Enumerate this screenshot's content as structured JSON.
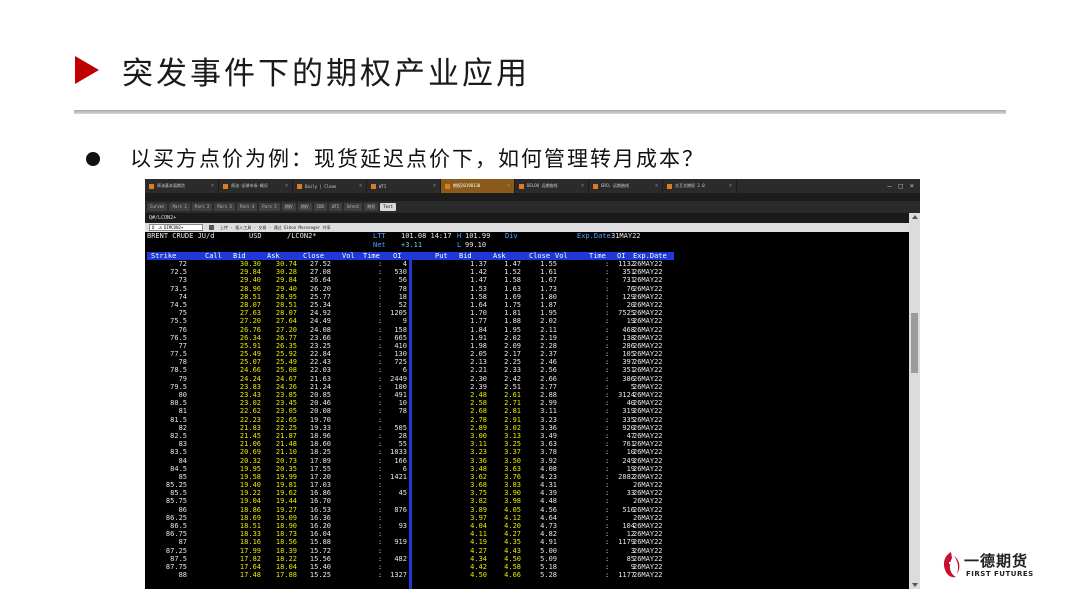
{
  "slide": {
    "title": "突发事件下的期权产业应用",
    "bullet": "以买方点价为例：现货延迟点价下，如何管理转月成本？"
  },
  "logo": {
    "cn": "一德期货",
    "en": "FIRST FUTURES",
    "icon": "first-futures-logo"
  },
  "colors": {
    "accent_red": "#c00000",
    "header_blue": "#1f39d8",
    "put_yellow": "#e8e800"
  },
  "terminal": {
    "tabs": [
      "原油基本面期货",
      "原油-全球市场-概况",
      "Daily | Clean",
      "WTI",
      "期权20190130",
      "DELOO 远期曲线",
      "GRCL 远期曲线",
      "交互式期权 2.0"
    ],
    "active_tab": 4,
    "function_tabs": [
      "Curves",
      "Pars 1",
      "Pars 2",
      "Pars 3",
      "Pars 4",
      "Pars 5",
      "期权",
      "期权",
      "CDD",
      "WTI",
      "Brent",
      "期权",
      "Test"
    ],
    "function_active": 12,
    "path": "Q#/LCON2+",
    "command_value": "Q .a DIMCON2+",
    "command_hint": "上传 · 插入工具 · 交易 · 通过 Eikon Messenger 共享",
    "header": {
      "instrument": "BRENT CRUDE JU/d",
      "currency": "USD",
      "ric": "/LCON2*",
      "ltt_label": "LTT",
      "ltt_value": "101.08 14:17",
      "h_label": "H",
      "h_value": "101.99",
      "div_label": "Div",
      "exp_label": "Exp.Date",
      "exp_value": "31MAY22",
      "net_label": "Net",
      "net_value": "+3.11",
      "l_label": "L",
      "l_value": "99.10"
    },
    "columns": {
      "strike": "Strike",
      "call": "Call",
      "bid": "Bid",
      "ask": "Ask",
      "close": "Close",
      "vol": "Vol",
      "time": "Time",
      "oi": "OI",
      "put": "Put",
      "put_bid": "Bid",
      "put_ask": "Ask",
      "put_close": "Close",
      "put_vol": "Vol",
      "put_time": "Time",
      "put_oi": "OI",
      "exp": "Exp.Date"
    },
    "rows": [
      [
        "72",
        "30.30",
        "30.74",
        "27.52",
        "4",
        "1.37",
        "1.47",
        "1.55",
        "1132",
        "26MAY22"
      ],
      [
        "72.5",
        "29.84",
        "30.28",
        "27.08",
        "530",
        "1.42",
        "1.52",
        "1.61",
        "351",
        "26MAY22"
      ],
      [
        "73",
        "29.40",
        "29.84",
        "26.64",
        "56",
        "1.47",
        "1.58",
        "1.67",
        "731",
        "26MAY22"
      ],
      [
        "73.5",
        "28.96",
        "29.40",
        "26.20",
        "78",
        "1.53",
        "1.63",
        "1.73",
        "76",
        "26MAY22"
      ],
      [
        "74",
        "28.51",
        "28.95",
        "25.77",
        "18",
        "1.58",
        "1.69",
        "1.80",
        "129",
        "26MAY22"
      ],
      [
        "74.5",
        "28.07",
        "28.51",
        "25.34",
        "52",
        "1.64",
        "1.75",
        "1.87",
        "20",
        "26MAY22"
      ],
      [
        "75",
        "27.63",
        "28.07",
        "24.92",
        "1205",
        "1.70",
        "1.81",
        "1.95",
        "7525",
        "26MAY22"
      ],
      [
        "75.5",
        "27.20",
        "27.64",
        "24.49",
        "9",
        "1.77",
        "1.88",
        "2.02",
        "19",
        "26MAY22"
      ],
      [
        "76",
        "26.76",
        "27.20",
        "24.08",
        "158",
        "1.84",
        "1.95",
        "2.11",
        "468",
        "26MAY22"
      ],
      [
        "76.5",
        "26.34",
        "26.77",
        "23.66",
        "665",
        "1.91",
        "2.02",
        "2.19",
        "138",
        "26MAY22"
      ],
      [
        "77",
        "25.91",
        "26.35",
        "23.25",
        "410",
        "1.98",
        "2.09",
        "2.28",
        "286",
        "26MAY22"
      ],
      [
        "77.5",
        "25.49",
        "25.92",
        "22.84",
        "130",
        "2.05",
        "2.17",
        "2.37",
        "105",
        "26MAY22"
      ],
      [
        "78",
        "25.07",
        "25.49",
        "22.43",
        "725",
        "2.13",
        "2.25",
        "2.46",
        "397",
        "26MAY22"
      ],
      [
        "78.5",
        "24.66",
        "25.08",
        "22.03",
        "6",
        "2.21",
        "2.33",
        "2.56",
        "351",
        "26MAY22"
      ],
      [
        "79",
        "24.24",
        "24.67",
        "21.63",
        "2449",
        "2.30",
        "2.42",
        "2.66",
        "386",
        "26MAY22"
      ],
      [
        "79.5",
        "23.83",
        "24.26",
        "21.24",
        "100",
        "2.39",
        "2.51",
        "2.77",
        "5",
        "26MAY22"
      ],
      [
        "80",
        "23.43",
        "23.85",
        "20.85",
        "491",
        "2.48",
        "2.61",
        "2.88",
        "3124",
        "26MAY22"
      ],
      [
        "80.5",
        "23.02",
        "23.45",
        "20.46",
        "10",
        "2.58",
        "2.71",
        "2.99",
        "40",
        "26MAY22"
      ],
      [
        "81",
        "22.62",
        "23.05",
        "20.08",
        "78",
        "2.68",
        "2.81",
        "3.11",
        "319",
        "26MAY22"
      ],
      [
        "81.5",
        "22.23",
        "22.65",
        "19.70",
        "",
        "2.78",
        "2.91",
        "3.23",
        "335",
        "26MAY22"
      ],
      [
        "82",
        "21.83",
        "22.25",
        "19.33",
        "505",
        "2.89",
        "3.02",
        "3.36",
        "920",
        "26MAY22"
      ],
      [
        "82.5",
        "21.45",
        "21.87",
        "18.96",
        "28",
        "3.00",
        "3.13",
        "3.49",
        "47",
        "26MAY22"
      ],
      [
        "83",
        "21.06",
        "21.48",
        "18.60",
        "55",
        "3.11",
        "3.25",
        "3.63",
        "761",
        "26MAY22"
      ],
      [
        "83.5",
        "20.69",
        "21.10",
        "18.25",
        "1033",
        "3.23",
        "3.37",
        "3.78",
        "10",
        "26MAY22"
      ],
      [
        "84",
        "20.32",
        "20.73",
        "17.89",
        "166",
        "3.36",
        "3.50",
        "3.92",
        "249",
        "26MAY22"
      ],
      [
        "84.5",
        "19.95",
        "20.35",
        "17.55",
        "6",
        "3.48",
        "3.63",
        "4.08",
        "19",
        "26MAY22"
      ],
      [
        "85",
        "19.58",
        "19.99",
        "17.20",
        "1421",
        "3.62",
        "3.76",
        "4.23",
        "2882",
        "26MAY22"
      ],
      [
        "85.25",
        "19.40",
        "19.81",
        "17.03",
        "",
        "3.68",
        "3.83",
        "4.31",
        "",
        "26MAY22"
      ],
      [
        "85.5",
        "19.22",
        "19.62",
        "16.86",
        "45",
        "3.75",
        "3.90",
        "4.39",
        "33",
        "26MAY22"
      ],
      [
        "85.75",
        "19.04",
        "19.44",
        "16.70",
        "",
        "3.82",
        "3.98",
        "4.48",
        "",
        "26MAY22"
      ],
      [
        "86",
        "18.86",
        "19.27",
        "16.53",
        "876",
        "3.89",
        "4.05",
        "4.56",
        "516",
        "26MAY22"
      ],
      [
        "86.25",
        "18.69",
        "19.09",
        "16.36",
        "",
        "3.97",
        "4.12",
        "4.64",
        "",
        "26MAY22"
      ],
      [
        "86.5",
        "18.51",
        "18.90",
        "16.20",
        "93",
        "4.04",
        "4.20",
        "4.73",
        "104",
        "26MAY22"
      ],
      [
        "86.75",
        "18.33",
        "18.73",
        "16.04",
        "",
        "4.11",
        "4.27",
        "4.82",
        "12",
        "26MAY22"
      ],
      [
        "87",
        "18.16",
        "18.56",
        "15.88",
        "919",
        "4.19",
        "4.35",
        "4.91",
        "1179",
        "26MAY22"
      ],
      [
        "87.25",
        "17.99",
        "18.39",
        "15.72",
        "",
        "4.27",
        "4.43",
        "5.00",
        "3",
        "26MAY22"
      ],
      [
        "87.5",
        "17.82",
        "18.22",
        "15.56",
        "482",
        "4.34",
        "4.50",
        "5.09",
        "85",
        "26MAY22"
      ],
      [
        "87.75",
        "17.64",
        "18.04",
        "15.40",
        "",
        "4.42",
        "4.58",
        "5.18",
        "9",
        "26MAY22"
      ],
      [
        "88",
        "17.48",
        "17.88",
        "15.25",
        "1327",
        "4.50",
        "4.66",
        "5.28",
        "1177",
        "26MAY22"
      ]
    ]
  }
}
